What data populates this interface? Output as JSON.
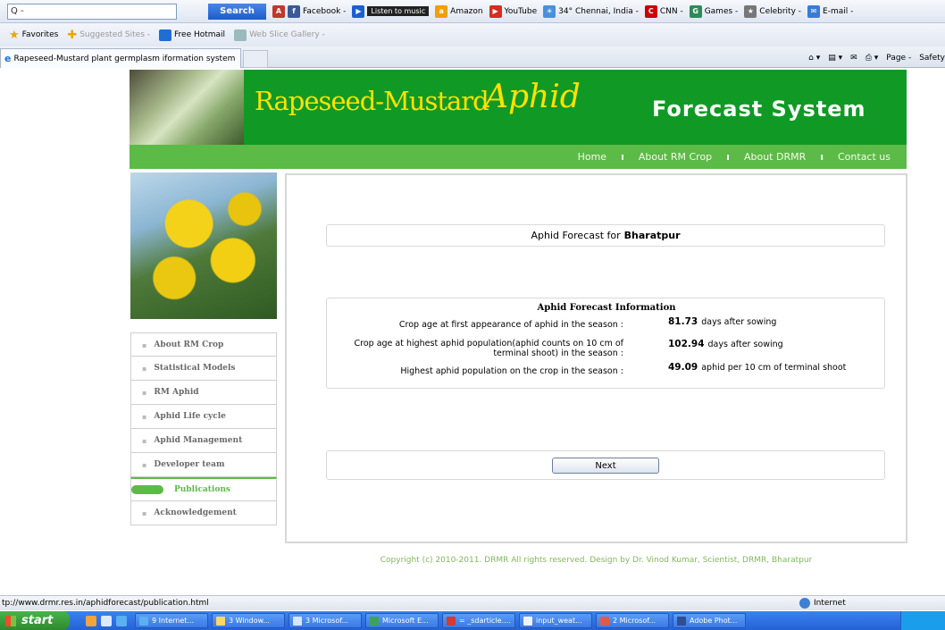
{
  "browser": {
    "search_box_value": "Q -",
    "search_button": "Search",
    "toolbar_items": [
      "Facebook -",
      "Listen to music",
      "Amazon",
      "YouTube",
      "34° Chennai, India -",
      "CNN -",
      "Games -",
      "Celebrity -",
      "E-mail -"
    ],
    "favorites_label": "Favorites",
    "favorites_items": [
      "Suggested Sites -",
      "Free Hotmail",
      "Web Slice Gallery -"
    ],
    "tab_title": "Rapeseed-Mustard plant germplasm iformation system",
    "cmd_items": [
      "Page -",
      "Safety"
    ],
    "status_url": "tp://www.drmr.res.in/aphidforecast/publication.html",
    "status_zone": "Internet"
  },
  "site": {
    "logo_part1": "Rapeseed-Mustard",
    "logo_part2": "Aphid",
    "logo_part3": "Forecast System",
    "nav": [
      "Home",
      "About RM Crop",
      "About DRMR",
      "Contact us"
    ],
    "sidebar": [
      "About RM Crop",
      "Statistical Models",
      "RM Aphid",
      "Aphid Life cycle",
      "Aphid Management",
      "Developer team",
      "Publications",
      "Acknowledgement"
    ],
    "forecast_title_prefix": "Aphid Forecast for",
    "forecast_location": "Bharatpur",
    "info_heading": "Aphid Forecast Information",
    "rows": [
      {
        "label": "Crop age at first appearance of aphid in the season :",
        "value": "81.73",
        "unit": "days after sowing"
      },
      {
        "label": "Crop age at highest aphid population(aphid counts on 10 cm of terminal shoot) in the season :",
        "value": "102.94",
        "unit": "days after sowing"
      },
      {
        "label": "Highest aphid population on the crop in the season :",
        "value": "49.09",
        "unit": "aphid per 10 cm of terminal shoot"
      }
    ],
    "next_button": "Next",
    "copyright": "Copyright (c) 2010-2011. DRMR All rights reserved. Design by Dr. Vinod Kumar, Scientist, DRMR, Bharatpur"
  },
  "taskbar": {
    "start": "start",
    "buttons": [
      "9 Internet...",
      "3 Window...",
      "3 Microsof...",
      "Microsoft E...",
      "= _sdarticle....",
      "input_weat...",
      "2 Microsof...",
      "Adobe Phot..."
    ]
  },
  "colors": {
    "header_green": "#109a25",
    "nav_green": "#5cba47",
    "logo_yellow": "#ffe100"
  }
}
